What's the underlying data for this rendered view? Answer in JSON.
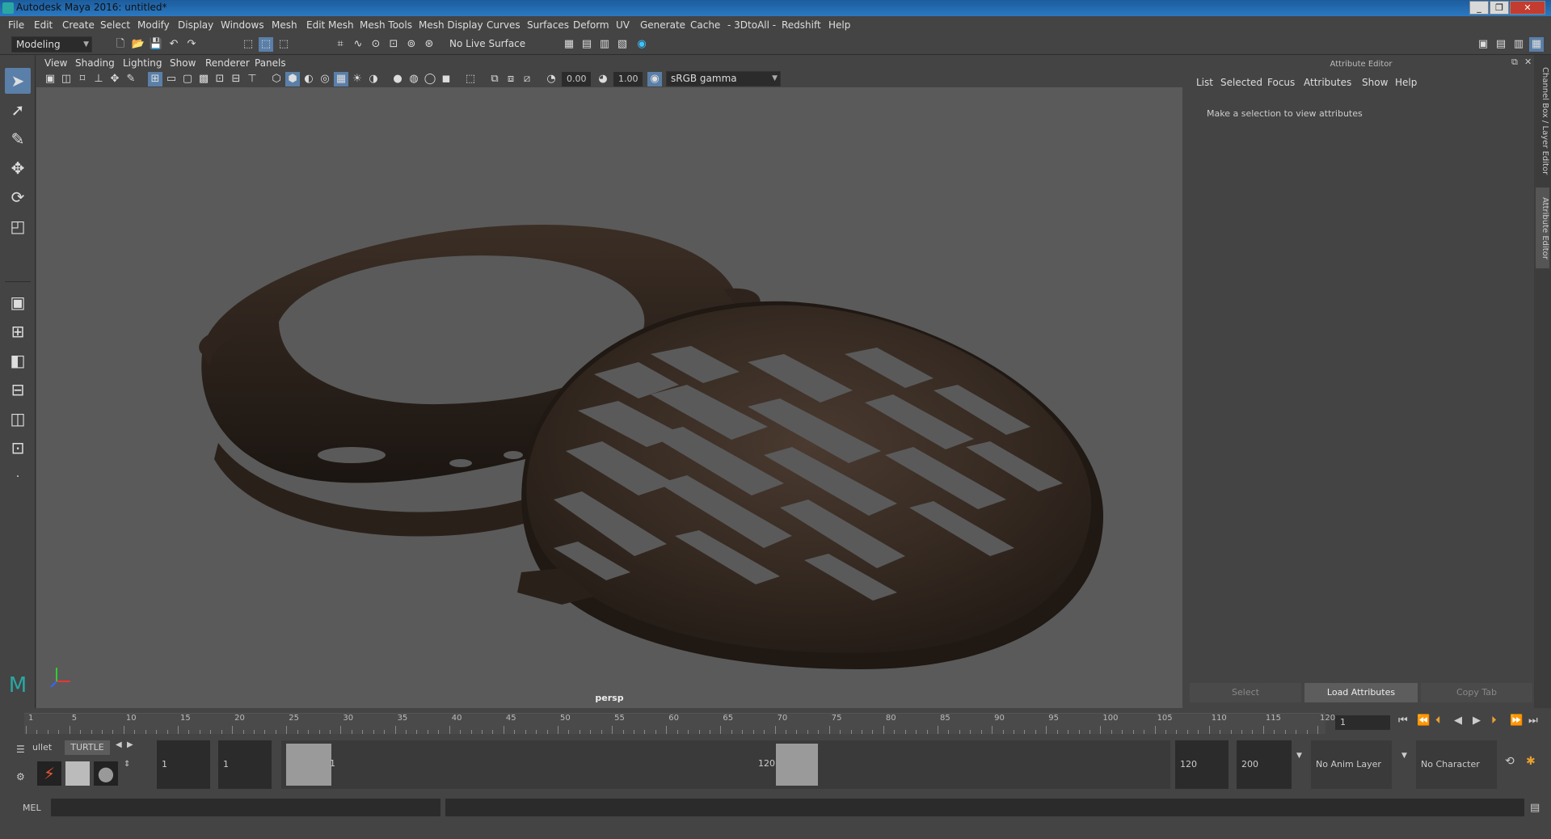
{
  "window": {
    "title": "Autodesk Maya 2016: untitled*",
    "controls": [
      "_",
      "❐",
      "✕"
    ]
  },
  "menubar": [
    "File",
    "Edit",
    "Create",
    "Select",
    "Modify",
    "Display",
    "Windows",
    "Mesh",
    "Edit Mesh",
    "Mesh Tools",
    "Mesh Display",
    "Curves",
    "Surfaces",
    "Deform",
    "UV",
    "Generate",
    "Cache",
    "- 3DtoAll -",
    "Redshift",
    "Help"
  ],
  "toolbar": {
    "mode": "Modeling",
    "live_surface": "No Live Surface"
  },
  "viewport": {
    "menu": [
      "View",
      "Shading",
      "Lighting",
      "Show",
      "Renderer",
      "Panels"
    ],
    "exposure": "0.00",
    "gamma": "1.00",
    "color_space": "sRGB gamma",
    "camera_label": "persp",
    "axis": {
      "x": "x",
      "y": "y",
      "z": "z"
    }
  },
  "attribute_editor": {
    "title": "Attribute Editor",
    "menu": [
      "List",
      "Selected",
      "Focus",
      "Attributes",
      "Show",
      "Help"
    ],
    "message": "Make a selection to view attributes",
    "buttons": {
      "select": "Select",
      "load": "Load Attributes",
      "copy": "Copy Tab"
    }
  },
  "side_tabs": {
    "channel_box": "Channel Box / Layer Editor",
    "attribute_editor": "Attribute Editor"
  },
  "timeline": {
    "ticks": [
      "1",
      "5",
      "10",
      "15",
      "20",
      "25",
      "30",
      "35",
      "40",
      "45",
      "50",
      "55",
      "60",
      "65",
      "70",
      "75",
      "80",
      "85",
      "90",
      "95",
      "100",
      "105",
      "110",
      "115",
      "120"
    ],
    "current_frame": "1"
  },
  "range": {
    "shelf_tabs": [
      "ullet",
      "TURTLE"
    ],
    "start": "1",
    "playback_start": "1",
    "range_start_label": "1",
    "range_end_label": "120",
    "playback_end": "120",
    "end": "200",
    "anim_layer": "No Anim Layer",
    "character_set": "No Character Set"
  },
  "cmdline": {
    "label": "MEL"
  },
  "colors": {
    "accent": "#5a7fa8",
    "viewport_bg": "#5a5a5a",
    "panel": "#444444",
    "field": "#2b2b2b"
  }
}
